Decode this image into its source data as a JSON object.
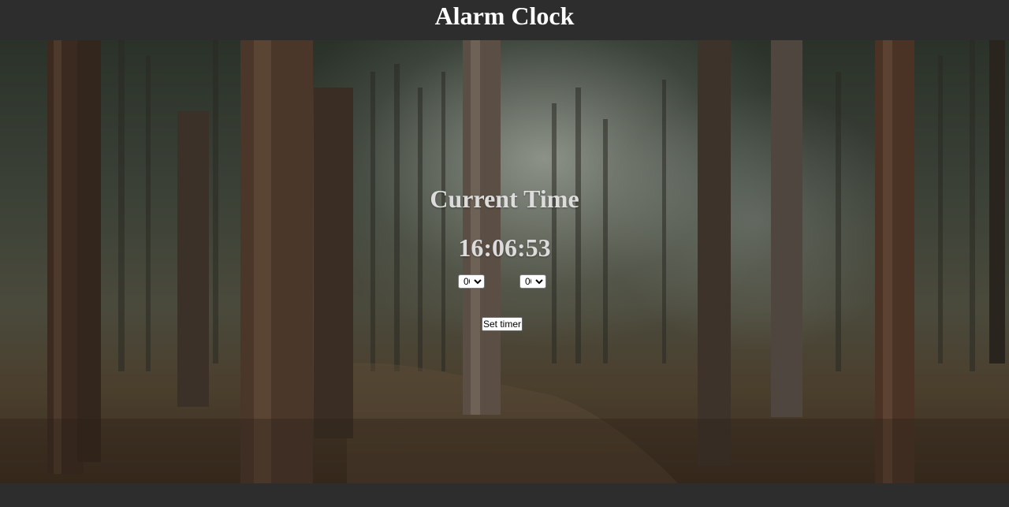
{
  "header": {
    "title": "Alarm Clock"
  },
  "main": {
    "section_title": "Current Time",
    "current_time": "16:06:53",
    "hour_select": {
      "selected": "00",
      "options": [
        "00"
      ]
    },
    "minute_select": {
      "selected": "00",
      "options": [
        "00"
      ]
    },
    "set_button_label": "Set timer"
  },
  "colors": {
    "bar_background": "#2d2d2d",
    "heading_text": "#ffffff",
    "clock_text": "#dcdcdc"
  }
}
